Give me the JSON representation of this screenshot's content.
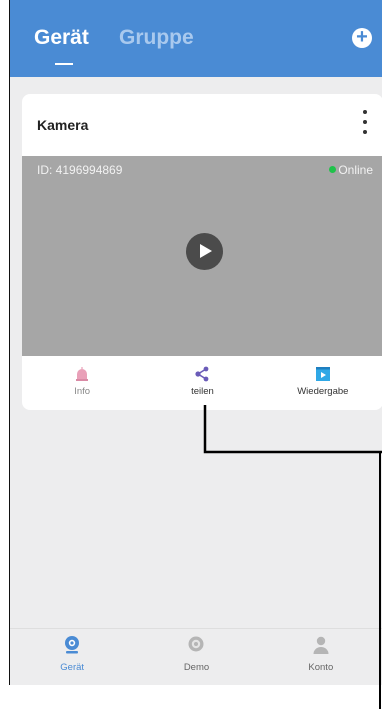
{
  "header": {
    "tabs": [
      {
        "label": "Gerät",
        "active": true
      },
      {
        "label": "Gruppe",
        "active": false
      }
    ],
    "add_icon": "plus-circle-icon"
  },
  "device_card": {
    "title": "Kamera",
    "menu_icon": "kebab-menu-icon",
    "id_label": "ID:  4196994869",
    "status": "Online",
    "status_color": "#1fc24a",
    "actions": [
      {
        "label": "Info",
        "icon": "info-bell-icon"
      },
      {
        "label": "teilen",
        "icon": "share-icon"
      },
      {
        "label": "Wiedergabe",
        "icon": "playback-icon"
      }
    ]
  },
  "bottom_nav": {
    "items": [
      {
        "label": "Gerät",
        "icon": "camera-icon",
        "active": true
      },
      {
        "label": "Demo",
        "icon": "demo-icon",
        "active": false
      },
      {
        "label": "Konto",
        "icon": "account-icon",
        "active": false
      }
    ]
  },
  "colors": {
    "header_blue": "#4a8bd4",
    "background": "#ededee",
    "video_gray": "#a6a6a6"
  }
}
